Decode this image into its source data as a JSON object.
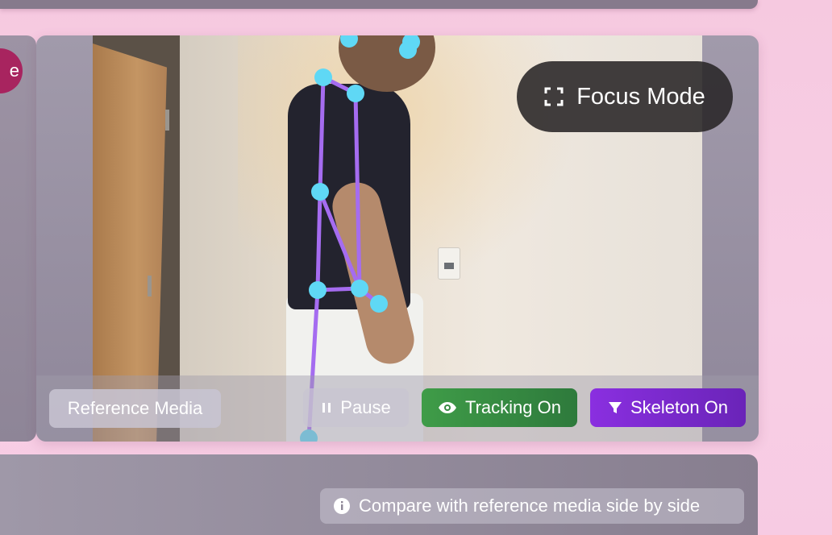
{
  "left_panel": {
    "pill_text": "e",
    "pill_color": "#a8245f"
  },
  "video": {
    "focus_mode_label": "Focus Mode",
    "icons": {
      "focus": "fullscreen-icon"
    }
  },
  "controls": {
    "reference_label": "Reference Media",
    "pause_label": "Pause",
    "tracking_label": "Tracking On",
    "skeleton_label": "Skeleton On",
    "icons": {
      "pause": "pause-icon",
      "tracking": "eye-icon",
      "skeleton": "filter-icon"
    },
    "colors": {
      "tracking": "#3f9c48",
      "skeleton": "#8a2fe0"
    }
  },
  "hint": {
    "text": "Compare with reference media side by side",
    "icon": "info-icon"
  },
  "skeleton": {
    "keypoint_color": "#5fd8f5",
    "bone_color": "#a56cf0"
  }
}
